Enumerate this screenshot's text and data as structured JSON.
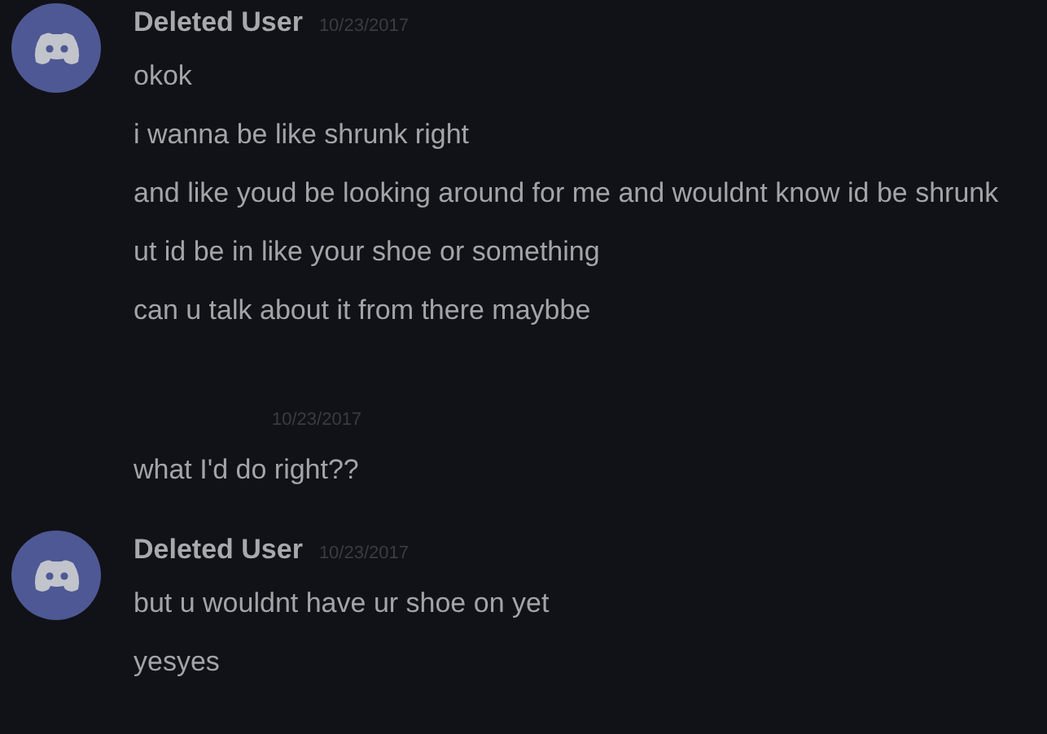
{
  "messages": [
    {
      "author": "Deleted User",
      "timestamp": "10/23/2017",
      "lines": [
        "okok",
        "i wanna be like shrunk right",
        "and like youd be looking around for me and wouldnt know id be shrunk",
        "ut id be in like your shoe or something",
        "can u talk about it from there maybbe"
      ]
    },
    {
      "timestamp": "10/23/2017",
      "lines": [
        "what I'd do right??"
      ]
    },
    {
      "author": "Deleted User",
      "timestamp": "10/23/2017",
      "lines": [
        "but u wouldnt have ur shoe on yet",
        "yesyes"
      ]
    }
  ]
}
